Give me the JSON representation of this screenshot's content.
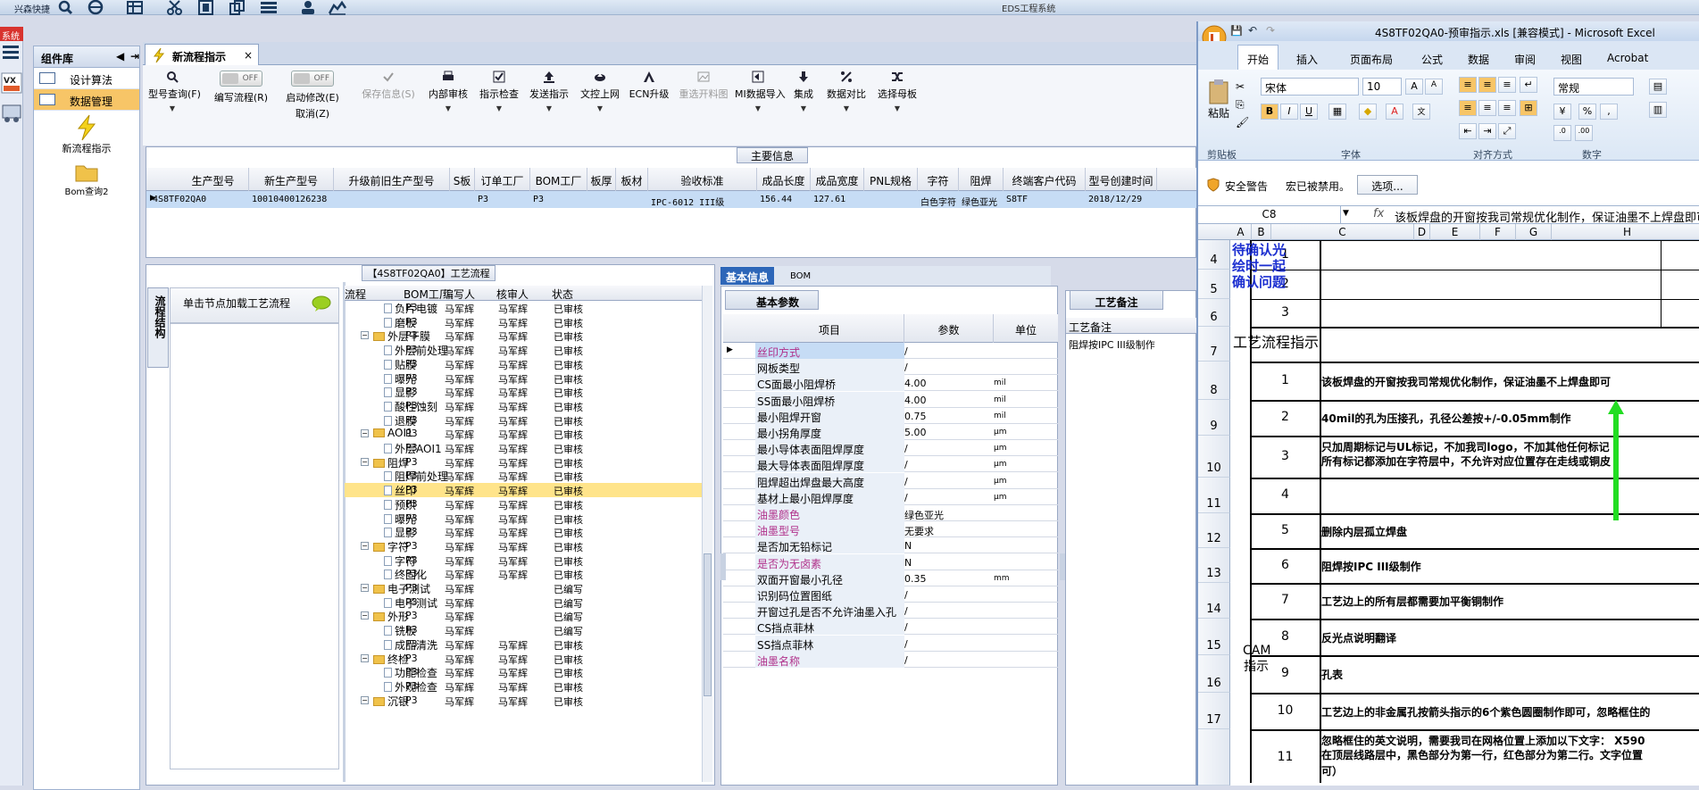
{
  "app": {
    "title_left": "兴森快捷",
    "center_title": "EDS工程系统",
    "red_tag": "系统"
  },
  "component_lib": {
    "title": "组件库",
    "items": [
      {
        "label": "设计算法"
      },
      {
        "label": "数据管理"
      }
    ],
    "big_items": [
      {
        "label": "新流程指示"
      },
      {
        "label": "Bom查询2"
      }
    ]
  },
  "main_tab": {
    "label": "新流程指示",
    "close": "×"
  },
  "toolbar": {
    "buttons": [
      {
        "label": "型号查询(F)"
      },
      {
        "label": "编写流程(R)",
        "toggle": "OFF"
      },
      {
        "label": "启动修改(E)",
        "toggle": "OFF",
        "sub": "取消(Z)"
      },
      {
        "label": "保存信息(S)"
      },
      {
        "label": "内部审核"
      },
      {
        "label": "指示检查"
      },
      {
        "label": "发送指示"
      },
      {
        "label": "文控上网"
      },
      {
        "label": "ECN升级"
      },
      {
        "label": "重选开料图"
      },
      {
        "label": "MI数据导入"
      },
      {
        "label": "集成"
      },
      {
        "label": "数据对比"
      },
      {
        "label": "选择母板"
      }
    ]
  },
  "main_info": {
    "section": "主要信息",
    "columns": [
      "生产型号",
      "新生产型号",
      "升级前旧生产型号",
      "S板",
      "订单工厂",
      "BOM工厂",
      "板厚",
      "板材",
      "验收标准",
      "成品长度",
      "成品宽度",
      "PNL规格",
      "字符",
      "阻焊",
      "终端客户代码",
      "型号创建时间"
    ],
    "row": [
      "4S8TF02QA0",
      "10010400126238",
      "",
      "",
      "P3",
      "P3",
      "",
      "",
      "IPC-6012 III级",
      "156.44",
      "127.61",
      "",
      "白色字符",
      "绿色亚光",
      "S8TF",
      "2018/12/29"
    ]
  },
  "process": {
    "title": "【4S8TF02QA0】工艺流程",
    "vtab": "流程结构",
    "load_hint": "单击节点加载工艺流程",
    "headers": [
      "流程",
      "BOM工厂",
      "编写人",
      "核审人",
      "状态"
    ],
    "rows": [
      {
        "name": "负片电镀",
        "level": 2,
        "bom": "P3",
        "writer": "马军辉",
        "reviewer": "马军辉",
        "status": "已审核"
      },
      {
        "name": "磨板",
        "level": 2,
        "bom": "P3",
        "writer": "马军辉",
        "reviewer": "马军辉",
        "status": "已审核"
      },
      {
        "name": "外层干膜",
        "level": 1,
        "bom": "P3",
        "writer": "马军辉",
        "reviewer": "马军辉",
        "status": "已审核"
      },
      {
        "name": "外层前处理",
        "level": 2,
        "bom": "P3",
        "writer": "马军辉",
        "reviewer": "马军辉",
        "status": "已审核"
      },
      {
        "name": "贴膜",
        "level": 2,
        "bom": "P3",
        "writer": "马军辉",
        "reviewer": "马军辉",
        "status": "已审核"
      },
      {
        "name": "曝光",
        "level": 2,
        "bom": "P3",
        "writer": "马军辉",
        "reviewer": "马军辉",
        "status": "已审核"
      },
      {
        "name": "显影",
        "level": 2,
        "bom": "P3",
        "writer": "马军辉",
        "reviewer": "马军辉",
        "status": "已审核"
      },
      {
        "name": "酸性蚀刻",
        "level": 2,
        "bom": "P3",
        "writer": "马军辉",
        "reviewer": "马军辉",
        "status": "已审核"
      },
      {
        "name": "退膜",
        "level": 2,
        "bom": "P3",
        "writer": "马军辉",
        "reviewer": "马军辉",
        "status": "已审核"
      },
      {
        "name": "AOI1",
        "level": 1,
        "bom": "P3",
        "writer": "马军辉",
        "reviewer": "马军辉",
        "status": "已审核"
      },
      {
        "name": "外层AOI1",
        "level": 2,
        "bom": "P3",
        "writer": "马军辉",
        "reviewer": "马军辉",
        "status": "已审核"
      },
      {
        "name": "阻焊",
        "level": 1,
        "bom": "P3",
        "writer": "马军辉",
        "reviewer": "马军辉",
        "status": "已审核"
      },
      {
        "name": "阻焊前处理",
        "level": 2,
        "bom": "P3",
        "writer": "马军辉",
        "reviewer": "马军辉",
        "status": "已审核"
      },
      {
        "name": "丝印",
        "level": 2,
        "bom": "P3",
        "writer": "马军辉",
        "reviewer": "马军辉",
        "status": "已审核",
        "selected": true
      },
      {
        "name": "预烘",
        "level": 2,
        "bom": "P3",
        "writer": "马军辉",
        "reviewer": "马军辉",
        "status": "已审核"
      },
      {
        "name": "曝光",
        "level": 2,
        "bom": "P3",
        "writer": "马军辉",
        "reviewer": "马军辉",
        "status": "已审核"
      },
      {
        "name": "显影",
        "level": 2,
        "bom": "P3",
        "writer": "马军辉",
        "reviewer": "马军辉",
        "status": "已审核"
      },
      {
        "name": "字符",
        "level": 1,
        "bom": "P3",
        "writer": "马军辉",
        "reviewer": "马军辉",
        "status": "已审核"
      },
      {
        "name": "字符",
        "level": 2,
        "bom": "P3",
        "writer": "马军辉",
        "reviewer": "马军辉",
        "status": "已审核"
      },
      {
        "name": "终固化",
        "level": 2,
        "bom": "P3",
        "writer": "马军辉",
        "reviewer": "马军辉",
        "status": "已审核"
      },
      {
        "name": "电子测试",
        "level": 1,
        "bom": "P3",
        "writer": "马军辉",
        "reviewer": "",
        "status": "已编写"
      },
      {
        "name": "电子测试",
        "level": 2,
        "bom": "P3",
        "writer": "马军辉",
        "reviewer": "",
        "status": "已编写"
      },
      {
        "name": "外形",
        "level": 1,
        "bom": "P3",
        "writer": "马军辉",
        "reviewer": "",
        "status": "已编写"
      },
      {
        "name": "铣板",
        "level": 2,
        "bom": "P3",
        "writer": "马军辉",
        "reviewer": "",
        "status": "已编写"
      },
      {
        "name": "成品清洗",
        "level": 2,
        "bom": "P3",
        "writer": "马军辉",
        "reviewer": "马军辉",
        "status": "已审核"
      },
      {
        "name": "终检",
        "level": 1,
        "bom": "P3",
        "writer": "马军辉",
        "reviewer": "马军辉",
        "status": "已审核"
      },
      {
        "name": "功能检查",
        "level": 2,
        "bom": "P3",
        "writer": "马军辉",
        "reviewer": "马军辉",
        "status": "已审核"
      },
      {
        "name": "外观检查",
        "level": 2,
        "bom": "P3",
        "writer": "马军辉",
        "reviewer": "马军辉",
        "status": "已审核"
      },
      {
        "name": "沉银",
        "level": 1,
        "bom": "P3",
        "writer": "马军辉",
        "reviewer": "马军辉",
        "status": "已审核"
      }
    ]
  },
  "basic": {
    "tabs": [
      "基本信息",
      "BOM"
    ],
    "sub_tab": "基本参数",
    "headers": [
      "项目",
      "参数",
      "单位"
    ],
    "rows": [
      {
        "k": "丝印方式",
        "v": "/",
        "u": "",
        "pink": true
      },
      {
        "k": "网板类型",
        "v": "/",
        "u": ""
      },
      {
        "k": "CS面最小阻焊桥",
        "v": "4.00",
        "u": "mil"
      },
      {
        "k": "SS面最小阻焊桥",
        "v": "4.00",
        "u": "mil"
      },
      {
        "k": "最小阻焊开窗",
        "v": "0.75",
        "u": "mil"
      },
      {
        "k": "最小拐角厚度",
        "v": "5.00",
        "u": "μm"
      },
      {
        "k": "最小导体表面阻焊厚度",
        "v": "/",
        "u": "μm"
      },
      {
        "k": "最大导体表面阻焊厚度",
        "v": "/",
        "u": "μm"
      },
      {
        "k": "阻焊超出焊盘最大高度",
        "v": "/",
        "u": "μm"
      },
      {
        "k": "基材上最小阻焊厚度",
        "v": "/",
        "u": "μm"
      },
      {
        "k": "油墨颜色",
        "v": "绿色亚光",
        "u": "",
        "pink": true
      },
      {
        "k": "油墨型号",
        "v": "无要求",
        "u": "",
        "pink": true
      },
      {
        "k": "是否加无铅标记",
        "v": "N",
        "u": ""
      },
      {
        "k": "是否为无卤素",
        "v": "N",
        "u": "",
        "pink": true
      },
      {
        "k": "双面开窗最小孔径",
        "v": "0.35",
        "u": "mm"
      },
      {
        "k": "识别码位置图纸",
        "v": "/",
        "u": ""
      },
      {
        "k": "开窗过孔是否不允许油墨入孔",
        "v": "/",
        "u": ""
      },
      {
        "k": "CS挡点菲林",
        "v": "/",
        "u": ""
      },
      {
        "k": "SS挡点菲林",
        "v": "/",
        "u": ""
      },
      {
        "k": "油墨名称",
        "v": "/",
        "u": "",
        "pink": true
      }
    ]
  },
  "remarks": {
    "tab": "工艺备注",
    "header": "工艺备注",
    "text": "阻焊按IPC III级制作"
  },
  "excel": {
    "title": "4S8TF02QA0-预审指示.xls [兼容模式] - Microsoft Excel",
    "tabs": [
      "开始",
      "插入",
      "页面布局",
      "公式",
      "数据",
      "审阅",
      "视图",
      "Acrobat"
    ],
    "font_name": "宋体",
    "font_size": "10",
    "number_format": "常规",
    "paste": "粘贴",
    "groups": [
      "剪贴板",
      "字体",
      "对齐方式",
      "数字"
    ],
    "security_label": "安全警告",
    "security_msg": "宏已被禁用。",
    "options_btn": "选项...",
    "name_box": "C8",
    "fx": "fx",
    "formula": "该板焊盘的开窗按我司常规优化制作，保证油墨不上焊盘即可",
    "columns": [
      "A",
      "B",
      "C",
      "D",
      "E",
      "F",
      "G",
      "H"
    ],
    "pending_label": "待确认光绘时一起确认问题",
    "flow_label": "工艺流程指示",
    "cam_label": "CAM指示",
    "rows": [
      {
        "rn": "4",
        "b": "1",
        "c": ""
      },
      {
        "rn": "5",
        "b": "2",
        "c": ""
      },
      {
        "rn": "6",
        "b": "3",
        "c": ""
      },
      {
        "rn": "7",
        "b": "",
        "c": ""
      },
      {
        "rn": "8",
        "b": "1",
        "c": "该板焊盘的开窗按我司常规优化制作，保证油墨不上焊盘即可"
      },
      {
        "rn": "9",
        "b": "2",
        "c": "40mil的孔为压接孔，孔径公差按+/-0.05mm制作"
      },
      {
        "rn": "10",
        "b": "3",
        "c": "只加周期标记与UL标记，不加我司logo，不加其他任何标记",
        "c2": "所有标记都添加在字符层中，不允许对应位置存在走线或铜皮"
      },
      {
        "rn": "11",
        "b": "4",
        "c": ""
      },
      {
        "rn": "12",
        "b": "5",
        "c": "删除内层孤立焊盘"
      },
      {
        "rn": "13",
        "b": "6",
        "c": "阻焊按IPC III级制作"
      },
      {
        "rn": "14",
        "b": "7",
        "c": "工艺边上的所有层都需要加平衡铜制作"
      },
      {
        "rn": "15",
        "b": "8",
        "c": "反光点说明翻译"
      },
      {
        "rn": "16",
        "b": "9",
        "c": "孔表"
      },
      {
        "rn": "17",
        "b": "10",
        "c": "工艺边上的非金属孔按箭头指示的6个紫色圆圈制作即可，忽略框住的"
      },
      {
        "rn": "",
        "b": "11",
        "c": "忽略框住的英文说明，需要我司在网格位置上添加以下文字： X590",
        "c2": "在顶层线路层中，黑色部分为第一行，红色部分为第二行。文字位置",
        "c3": "可）"
      }
    ]
  },
  "colors": {
    "accent": "#f7c567",
    "selected_row": "#c6dcf5",
    "arrow": "#22dd22"
  }
}
